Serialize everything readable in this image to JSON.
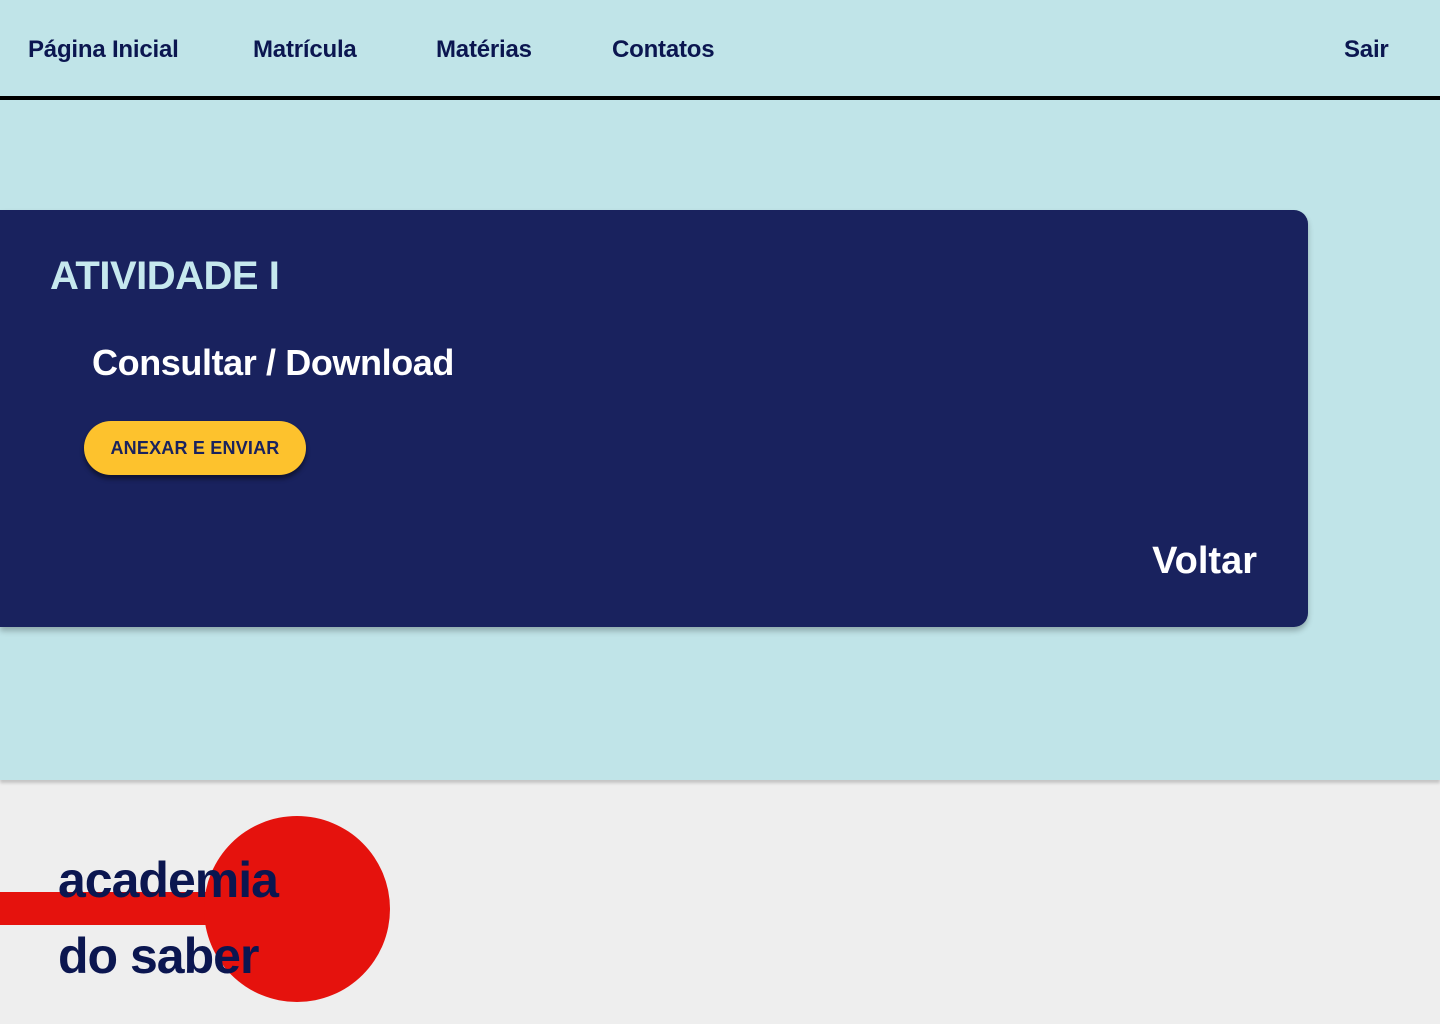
{
  "nav": {
    "home": "Página Inicial",
    "enrollment": "Matrícula",
    "subjects": "Matérias",
    "contacts": "Contatos",
    "logout": "Sair"
  },
  "activity": {
    "title": "ATIVIDADE I",
    "consult_link": "Consultar / Download",
    "attach_button": "ANEXAR E ENVIAR",
    "back_link": "Voltar"
  },
  "footer": {
    "logo_line1": "academia",
    "logo_line2": "do saber"
  },
  "colors": {
    "background_main": "#c0e4e8",
    "background_footer": "#eeeeee",
    "card": "#19225e",
    "nav_text": "#0b1650",
    "title_text": "#c6e8ee",
    "button": "#fdc22d",
    "logo_red": "#e5120d"
  }
}
